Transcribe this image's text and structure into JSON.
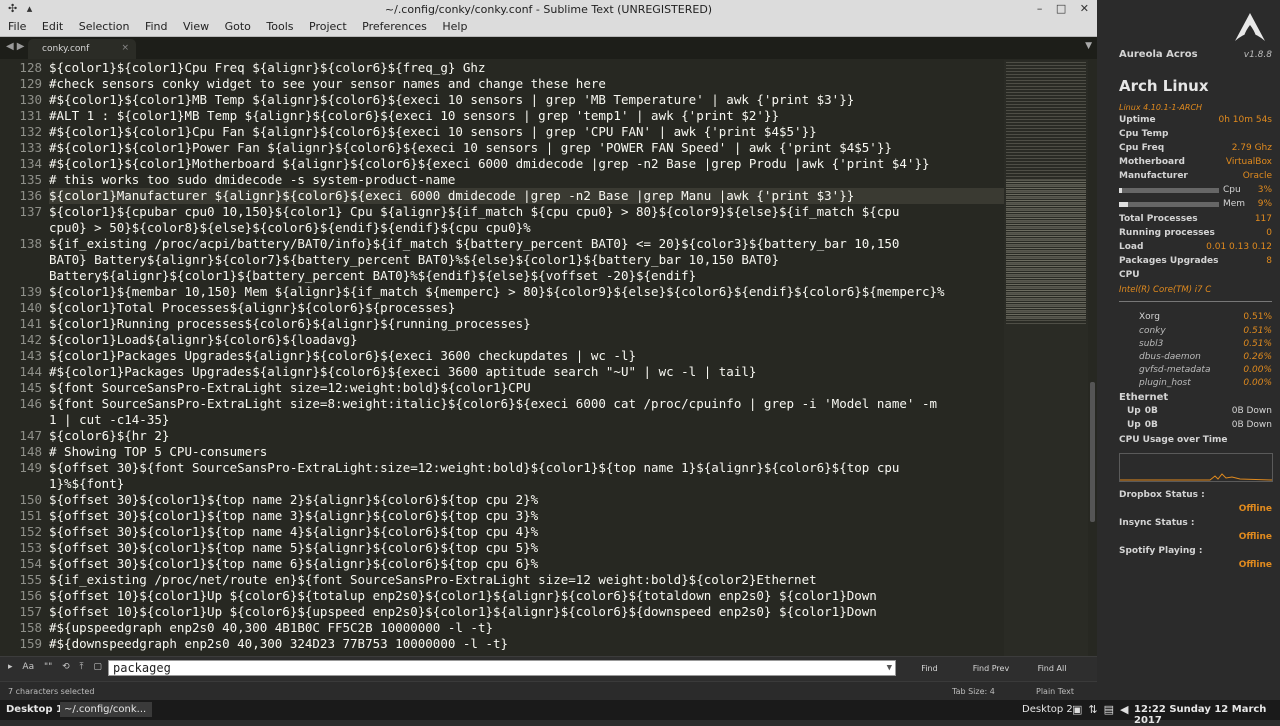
{
  "window": {
    "title": "~/.config/conky/conky.conf - Sublime Text (UNREGISTERED)",
    "controls": [
      "–",
      "□",
      "✕"
    ],
    "left_icons": [
      "✣",
      "▴"
    ]
  },
  "menu": [
    "File",
    "Edit",
    "Selection",
    "Find",
    "View",
    "Goto",
    "Tools",
    "Project",
    "Preferences",
    "Help"
  ],
  "tab": {
    "name": "conky.conf",
    "close": "×"
  },
  "editor": {
    "lines": [
      {
        "n": "128",
        "t": "${color1}${color1}Cpu Freq ${alignr}${color6}${freq_g} Ghz"
      },
      {
        "n": "129",
        "t": "#check sensors conky widget to see your sensor names and change these here"
      },
      {
        "n": "130",
        "t": "#${color1}${color1}MB Temp ${alignr}${color6}${execi 10 sensors | grep 'MB Temperature' | awk {'print $3'}}"
      },
      {
        "n": "131",
        "t": "#ALT 1 : ${color1}MB Temp ${alignr}${color6}${execi 10 sensors | grep 'temp1' | awk {'print $2'}}"
      },
      {
        "n": "132",
        "t": "#${color1}${color1}Cpu Fan ${alignr}${color6}${execi 10 sensors | grep 'CPU FAN' | awk {'print $4$5'}}"
      },
      {
        "n": "133",
        "t": "#${color1}${color1}Power Fan ${alignr}${color6}${execi 10 sensors | grep 'POWER FAN Speed' | awk {'print $4$5'}}"
      },
      {
        "n": "134",
        "t": "#${color1}${color1}Motherboard ${alignr}${color6}${execi 6000 dmidecode |grep -n2 Base |grep Produ |awk {'print $4'}}"
      },
      {
        "n": "135",
        "t": "# this works too sudo dmidecode -s system-product-name"
      },
      {
        "n": "136",
        "t": "${color1}Manufacturer ${alignr}${color6}${execi 6000 dmidecode |grep -n2 Base |grep Manu |awk {'print $3'}}",
        "sel": true
      },
      {
        "n": "137",
        "t": "${color1}${cpubar cpu0 10,150}${color1} Cpu ${alignr}${if_match ${cpu cpu0} > 80}${color9}${else}${if_match ${cpu"
      },
      {
        "n": "",
        "t": "cpu0} > 50}${color8}${else}${color6}${endif}${endif}${cpu cpu0}%"
      },
      {
        "n": "138",
        "t": "${if_existing /proc/acpi/battery/BAT0/info}${if_match ${battery_percent BAT0} <= 20}${color3}${battery_bar 10,150"
      },
      {
        "n": "",
        "t": "BAT0} Battery${alignr}${color7}${battery_percent BAT0}%${else}${color1}${battery_bar 10,150 BAT0}"
      },
      {
        "n": "",
        "t": "Battery${alignr}${color1}${battery_percent BAT0}%${endif}${else}${voffset -20}${endif}"
      },
      {
        "n": "139",
        "t": "${color1}${membar 10,150} Mem ${alignr}${if_match ${memperc} > 80}${color9}${else}${color6}${endif}${color6}${memperc}%"
      },
      {
        "n": "140",
        "t": "${color1}Total Processes${alignr}${color6}${processes}"
      },
      {
        "n": "141",
        "t": "${color1}Running processes${color6}${alignr}${running_processes}"
      },
      {
        "n": "142",
        "t": "${color1}Load${alignr}${color6}${loadavg}"
      },
      {
        "n": "143",
        "t": "${color1}Packages Upgrades${alignr}${color6}${execi 3600 checkupdates | wc -l}"
      },
      {
        "n": "144",
        "t": "#${color1}Packages Upgrades${alignr}${color6}${execi 3600 aptitude search \"~U\" | wc -l | tail}"
      },
      {
        "n": "145",
        "t": "${font SourceSansPro-ExtraLight size=12:weight:bold}${color1}CPU"
      },
      {
        "n": "146",
        "t": "${font SourceSansPro-ExtraLight size=8:weight:italic}${color6}${execi 6000 cat /proc/cpuinfo | grep -i 'Model name' -m"
      },
      {
        "n": "",
        "t": "1 | cut -c14-35}"
      },
      {
        "n": "147",
        "t": "${color6}${hr 2}"
      },
      {
        "n": "148",
        "t": "# Showing TOP 5 CPU-consumers"
      },
      {
        "n": "149",
        "t": "${offset 30}${font SourceSansPro-ExtraLight:size=12:weight:bold}${color1}${top name 1}${alignr}${color6}${top cpu"
      },
      {
        "n": "",
        "t": "1}%${font}"
      },
      {
        "n": "150",
        "t": "${offset 30}${color1}${top name 2}${alignr}${color6}${top cpu 2}%"
      },
      {
        "n": "151",
        "t": "${offset 30}${color1}${top name 3}${alignr}${color6}${top cpu 3}%"
      },
      {
        "n": "152",
        "t": "${offset 30}${color1}${top name 4}${alignr}${color6}${top cpu 4}%"
      },
      {
        "n": "153",
        "t": "${offset 30}${color1}${top name 5}${alignr}${color6}${top cpu 5}%"
      },
      {
        "n": "154",
        "t": "${offset 30}${color1}${top name 6}${alignr}${color6}${top cpu 6}%"
      },
      {
        "n": "155",
        "t": "${if_existing /proc/net/route en}${font SourceSansPro-ExtraLight size=12 weight:bold}${color2}Ethernet"
      },
      {
        "n": "156",
        "t": "${offset 10}${color1}Up ${color6}${totalup enp2s0}${color1}${alignr}${color6}${totaldown enp2s0} ${color1}Down"
      },
      {
        "n": "157",
        "t": "${offset 10}${color1}Up ${color6}${upspeed enp2s0}${color1}${alignr}${color6}${downspeed enp2s0} ${color1}Down"
      },
      {
        "n": "158",
        "t": "#${upspeedgraph enp2s0 40,300 4B1B0C FF5C2B 10000000 -l -t}"
      },
      {
        "n": "159",
        "t": "#${downspeedgraph enp2s0 40,300 324D23 77B753 10000000 -l -t}"
      }
    ]
  },
  "findbar": {
    "options": [
      "▸",
      "Aa",
      "\"\"",
      "⟲",
      "⤒",
      "▢"
    ],
    "query": "packageg",
    "buttons": [
      "Find",
      "Find Prev",
      "Find All"
    ]
  },
  "status": {
    "selection": "7 characters selected",
    "tab_size": "Tab Size: 4",
    "syntax": "Plain Text"
  },
  "conky": {
    "brand": "Aureola Acros",
    "version": "v1.8.8",
    "os": "Arch Linux",
    "kernel": "Linux 4.10.1-1-ARCH",
    "rows": [
      {
        "k": "Uptime",
        "v": "0h 10m 54s"
      },
      {
        "k": "Cpu Temp",
        "v": ""
      },
      {
        "k": "Cpu Freq",
        "v": "2.79 Ghz"
      },
      {
        "k": "Motherboard",
        "v": "VirtualBox"
      },
      {
        "k": "Manufacturer",
        "v": "Oracle"
      }
    ],
    "cpu": {
      "label": "Cpu",
      "value": "3%",
      "fill": 0.03
    },
    "mem": {
      "label": "Mem",
      "value": "9%",
      "fill": 0.09
    },
    "rows2": [
      {
        "k": "Total Processes",
        "v": "117"
      },
      {
        "k": "Running processes",
        "v": "0"
      },
      {
        "k": "Load",
        "v": "0.01 0.13 0.12"
      },
      {
        "k": "Packages Upgrades",
        "v": "8"
      },
      {
        "k": "CPU",
        "v": ""
      }
    ],
    "cpu_model": "Intel(R) Core(TM) i7 C",
    "top": [
      {
        "name": "Xorg",
        "v": "0.51%"
      },
      {
        "name": "conky",
        "v": "0.51%"
      },
      {
        "name": "subl3",
        "v": "0.51%"
      },
      {
        "name": "dbus-daemon",
        "v": "0.26%"
      },
      {
        "name": "gvfsd-metadata",
        "v": "0.00%"
      },
      {
        "name": "plugin_host",
        "v": "0.00%"
      }
    ],
    "ethernet": "Ethernet",
    "net": [
      {
        "up": "Up",
        "upv": "0B",
        "down": "0B Down"
      },
      {
        "up": "Up",
        "upv": "0B",
        "down": "0B Down"
      }
    ],
    "graph_title": "CPU Usage over Time",
    "services": [
      {
        "k": "Dropbox Status :",
        "v": "Offline"
      },
      {
        "k": "Insync Status :",
        "v": "Offline"
      },
      {
        "k": "Spotify Playing :",
        "v": "Offline"
      }
    ]
  },
  "taskbar": {
    "desktop1": "Desktop 1",
    "task": "~/.config/conk...",
    "desktop2": "Desktop 2",
    "clock": "12:22 Sunday 12 March 2017"
  }
}
